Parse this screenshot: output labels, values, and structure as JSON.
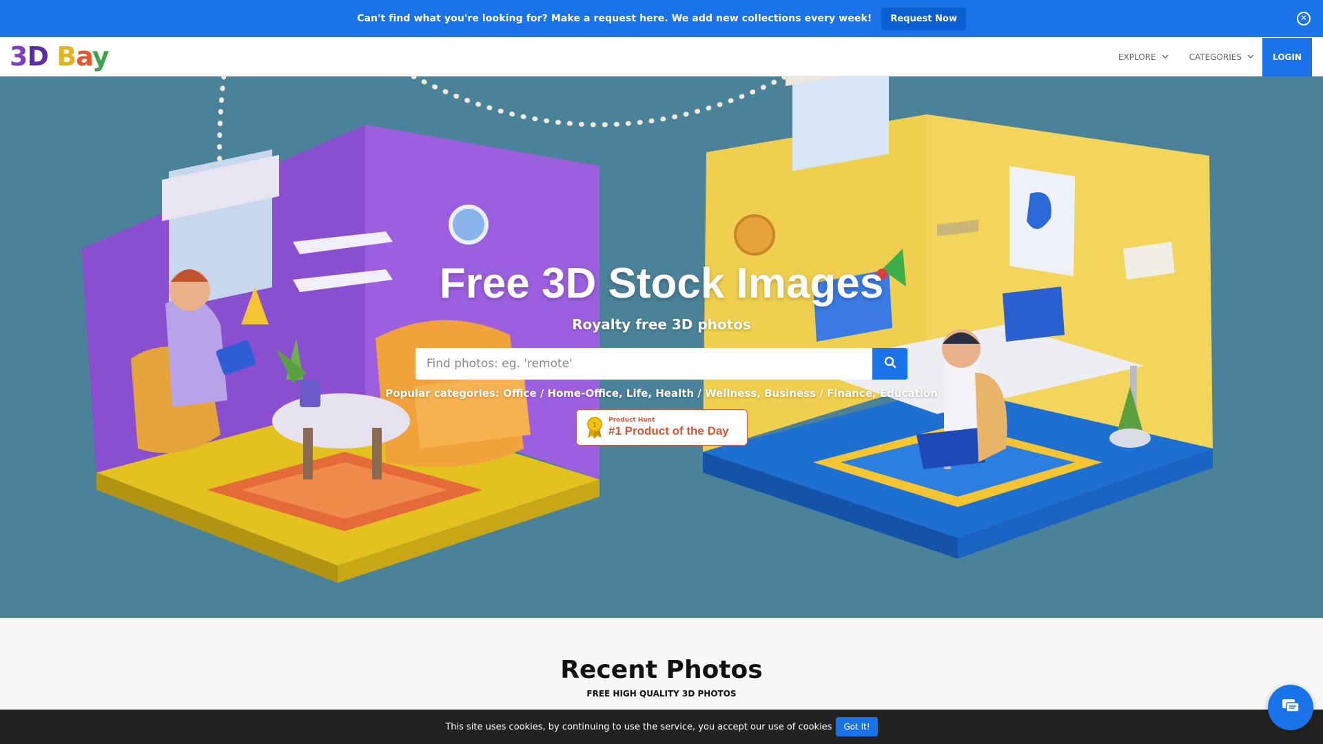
{
  "announcement": {
    "text": "Can't find what you're looking for? Make a request here. We add new collections every week!",
    "button_label": "Request Now",
    "close_icon": "close-circle-icon"
  },
  "nav": {
    "logo_text": "3D Bay",
    "explore_label": "EXPLORE",
    "categories_label": "CATEGORIES",
    "login_label": "LOGIN"
  },
  "hero": {
    "title": "Free 3D Stock Images",
    "subtitle": "Royalty free 3D photos",
    "search_placeholder": "Find photos: eg. 'remote'",
    "search_icon": "search-icon",
    "popular_label": "Popular categories:",
    "popular_categories": [
      "Office / Home-Office",
      "Life",
      "Health / Wellness",
      "Business / Finance",
      "Education"
    ],
    "product_hunt_small": "Product Hunt",
    "product_hunt_big": "#1 Product of the Day"
  },
  "recent": {
    "title": "Recent Photos",
    "subtitle": "FREE HIGH QUALITY 3D PHOTOS"
  },
  "cookie": {
    "text": "This site uses cookies, by continuing to use the service, you accept our use of cookies",
    "button_label": "Got It!"
  },
  "chat": {
    "icon": "chat-icon"
  },
  "colors": {
    "brand_blue": "#1a73e8",
    "hero_bg": "#4a8299",
    "product_hunt_orange": "#da552f"
  }
}
